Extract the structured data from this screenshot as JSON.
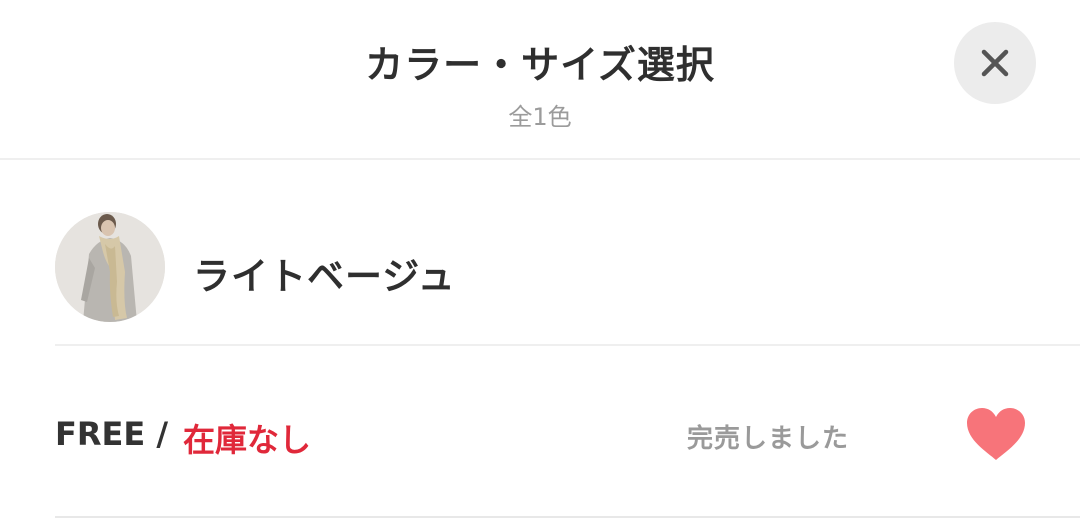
{
  "header": {
    "title": "カラー・サイズ選択",
    "subtitle": "全1色",
    "close_icon": "close-icon"
  },
  "color_option": {
    "name": "ライトベージュ",
    "thumbnail": "product-thumbnail"
  },
  "size_option": {
    "size": "FREE /",
    "stock_status": "在庫なし",
    "sold_out_text": "完売しました",
    "favorite_icon": "heart-icon"
  },
  "colors": {
    "stock_red": "#e0283a",
    "heart_pink": "#f7747a",
    "muted_gray": "#9a9a9a"
  }
}
